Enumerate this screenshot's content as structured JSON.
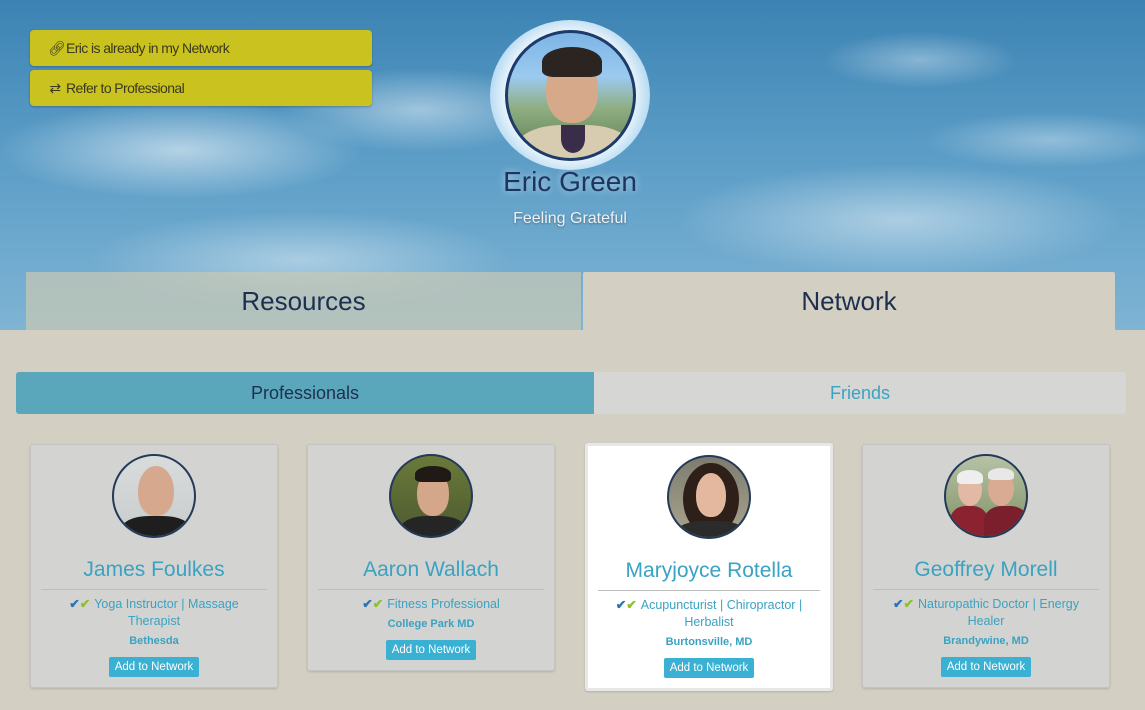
{
  "profile": {
    "name": "Eric Green",
    "status": "Feeling Grateful"
  },
  "actions": {
    "network_label": "Eric is already in my Network",
    "refer_label": "Refer to Professional"
  },
  "main_tabs": [
    {
      "label": "Resources",
      "active": false
    },
    {
      "label": "Network",
      "active": true
    }
  ],
  "sub_tabs": [
    {
      "label": "Professionals",
      "active": true
    },
    {
      "label": "Friends",
      "active": false
    }
  ],
  "cards": [
    {
      "name": "James Foulkes",
      "role": "Yoga Instructor | Massage Therapist",
      "location": "Bethesda",
      "button": "Add to Network",
      "highlighted": false
    },
    {
      "name": "Aaron Wallach",
      "role": "Fitness Professional",
      "location": "College Park MD",
      "button": "Add to Network",
      "highlighted": false
    },
    {
      "name": "Maryjoyce Rotella",
      "role": "Acupuncturist | Chiropractor | Herbalist",
      "location": "Burtonsville, MD",
      "button": "Add to Network",
      "highlighted": true
    },
    {
      "name": "Geoffrey Morell",
      "role": "Naturopathic Doctor | Energy Healer",
      "location": "Brandywine, MD",
      "button": "Add to Network",
      "highlighted": false
    }
  ],
  "icons": {
    "network_action": "link-icon",
    "refer_action": "transfer-arrows-icon",
    "verified": "verified-check-icon"
  },
  "colors": {
    "action_button": "#c9c21f",
    "accent_text": "#3aa2c2",
    "active_subtab": "#5aa6ba",
    "add_button": "#3ab0d2",
    "page_background": "#d3cfc2"
  }
}
